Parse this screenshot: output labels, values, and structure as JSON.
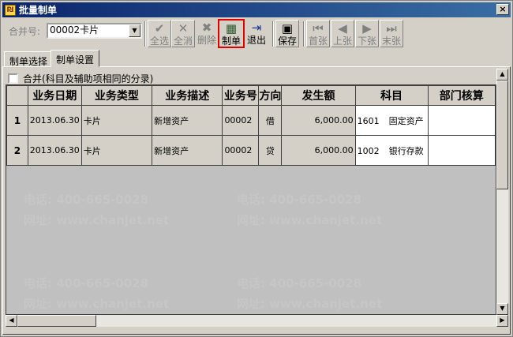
{
  "window": {
    "title": "批量制单",
    "app_icon": "app-icon",
    "close_label": "×"
  },
  "toolbar": {
    "merge_label": "合并号:",
    "merge_value": "00002卡片",
    "buttons": [
      {
        "id": "select-all",
        "label": "全选",
        "icon": "select-all-icon",
        "enabled": false
      },
      {
        "id": "deselect-all",
        "label": "全消",
        "icon": "deselect-all-icon",
        "enabled": false
      },
      {
        "id": "delete",
        "label": "删除",
        "icon": "delete-icon",
        "enabled": false
      },
      {
        "id": "make-voucher",
        "label": "制单",
        "icon": "voucher-icon",
        "enabled": true
      },
      {
        "id": "exit",
        "label": "退出",
        "icon": "exit-icon",
        "enabled": true
      },
      {
        "id": "save",
        "label": "保存",
        "icon": "save-icon",
        "enabled": true
      },
      {
        "id": "first",
        "label": "首张",
        "icon": "first-icon",
        "enabled": false
      },
      {
        "id": "prev",
        "label": "上张",
        "icon": "prev-icon",
        "enabled": false
      },
      {
        "id": "next",
        "label": "下张",
        "icon": "next-icon",
        "enabled": false
      },
      {
        "id": "last",
        "label": "末张",
        "icon": "last-icon",
        "enabled": false
      }
    ]
  },
  "tabs": [
    {
      "label": "制单选择",
      "selected": false
    },
    {
      "label": "制单设置",
      "selected": true
    }
  ],
  "merge_option": {
    "label": "合并(科目及辅助项相同的分录)",
    "checked": false
  },
  "table": {
    "columns": [
      "",
      "业务日期",
      "业务类型",
      "业务描述",
      "业务号",
      "方向",
      "发生额",
      "科目",
      "部门核算"
    ],
    "rows": [
      {
        "num": "1",
        "date": "2013.06.30",
        "type": "卡片",
        "desc": "新增资产",
        "no": "00002",
        "dir": "借",
        "amount": "6,000.00",
        "subject_code": "1601",
        "subject_name": "固定资产",
        "dept": ""
      },
      {
        "num": "2",
        "date": "2013.06.30",
        "type": "卡片",
        "desc": "新增资产",
        "no": "00002",
        "dir": "贷",
        "amount": "6,000.00",
        "subject_code": "1002",
        "subject_name": "银行存款",
        "dept": ""
      }
    ]
  },
  "watermark": {
    "phone": "电话: 400-665-0028",
    "site": "网址: www.chanjet.net"
  },
  "colors": {
    "titlebar": "#0a246a",
    "highlight": "#e00000",
    "face": "#d4d0c8"
  }
}
